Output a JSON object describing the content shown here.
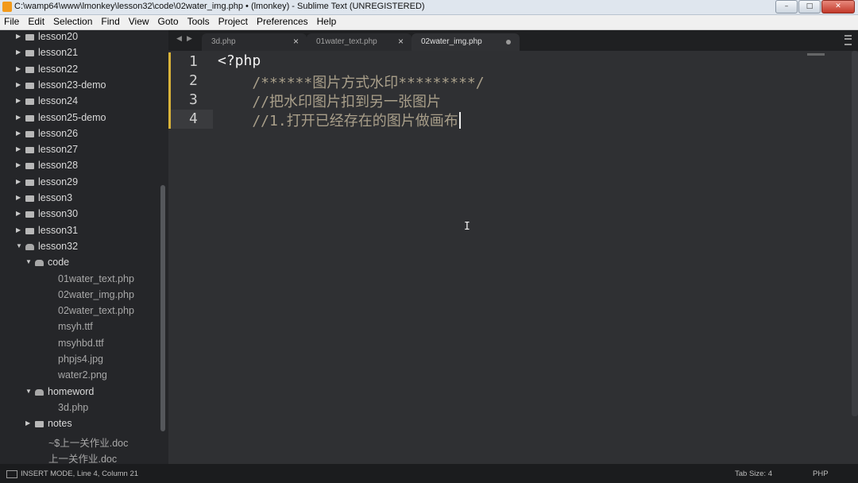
{
  "window": {
    "title": "C:\\wamp64\\www\\lmonkey\\lesson32\\code\\02water_img.php • (lmonkey) - Sublime Text (UNREGISTERED)",
    "controls": [
      "minimize",
      "maximize",
      "close"
    ]
  },
  "menu": [
    "File",
    "Edit",
    "Selection",
    "Find",
    "View",
    "Goto",
    "Tools",
    "Project",
    "Preferences",
    "Help"
  ],
  "sidebar": {
    "rows": [
      {
        "label": "lesson20",
        "kind": "folder",
        "depth": 0
      },
      {
        "label": "lesson21",
        "kind": "folder",
        "depth": 0
      },
      {
        "label": "lesson22",
        "kind": "folder",
        "depth": 0
      },
      {
        "label": "lesson23-demo",
        "kind": "folder",
        "depth": 0
      },
      {
        "label": "lesson24",
        "kind": "folder",
        "depth": 0
      },
      {
        "label": "lesson25-demo",
        "kind": "folder",
        "depth": 0
      },
      {
        "label": "lesson26",
        "kind": "folder",
        "depth": 0
      },
      {
        "label": "lesson27",
        "kind": "folder",
        "depth": 0
      },
      {
        "label": "lesson28",
        "kind": "folder",
        "depth": 0
      },
      {
        "label": "lesson29",
        "kind": "folder",
        "depth": 0
      },
      {
        "label": "lesson3",
        "kind": "folder",
        "depth": 0
      },
      {
        "label": "lesson30",
        "kind": "folder",
        "depth": 0
      },
      {
        "label": "lesson31",
        "kind": "folder",
        "depth": 0
      },
      {
        "label": "lesson32",
        "kind": "folder-open",
        "depth": 0
      },
      {
        "label": "code",
        "kind": "folder-open",
        "depth": 1
      },
      {
        "label": "01water_text.php",
        "kind": "file",
        "depth": 2
      },
      {
        "label": "02water_img.php",
        "kind": "file",
        "depth": 2
      },
      {
        "label": "02water_text.php",
        "kind": "file",
        "depth": 2
      },
      {
        "label": "msyh.ttf",
        "kind": "file",
        "depth": 2
      },
      {
        "label": "msyhbd.ttf",
        "kind": "file",
        "depth": 2
      },
      {
        "label": "phpjs4.jpg",
        "kind": "file",
        "depth": 2
      },
      {
        "label": "water2.png",
        "kind": "file",
        "depth": 2
      },
      {
        "label": "homeword",
        "kind": "folder-open",
        "depth": 1
      },
      {
        "label": "3d.php",
        "kind": "file",
        "depth": 2
      },
      {
        "label": "notes",
        "kind": "folder",
        "depth": 1
      },
      {
        "label": "~$上一关作业.doc",
        "kind": "file",
        "depth": 1
      },
      {
        "label": "上一关作业.doc",
        "kind": "file",
        "depth": 1
      }
    ]
  },
  "tabs": [
    {
      "label": "3d.php",
      "active": false,
      "dirty": false
    },
    {
      "label": "01water_text.php",
      "active": false,
      "dirty": false
    },
    {
      "label": "02water_img.php",
      "active": true,
      "dirty": true
    }
  ],
  "editor": {
    "lines": [
      {
        "number": "1",
        "text": "<?php",
        "style": "php-open"
      },
      {
        "number": "2",
        "text": "    /******图片方式水印*********/",
        "style": "comment"
      },
      {
        "number": "3",
        "text": "    //把水印图片扣到另一张图片",
        "style": "comment"
      },
      {
        "number": "4",
        "text": "    //1.打开已经存在的图片做画布",
        "style": "comment"
      }
    ],
    "cursor_line": 4
  },
  "status": {
    "mode": "INSERT MODE, Line 4, Column 21",
    "tab_size": "Tab Size: 4",
    "syntax": "PHP"
  }
}
